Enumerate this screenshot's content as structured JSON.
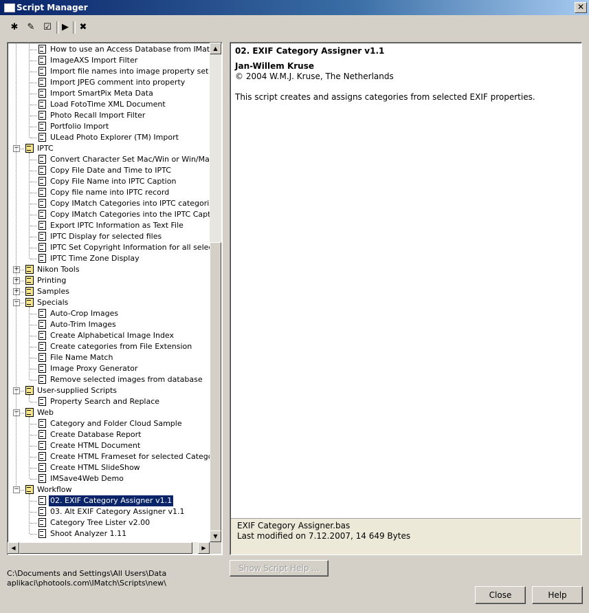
{
  "window": {
    "title": "Script Manager",
    "close_glyph": "✕"
  },
  "toolbar": [
    {
      "name": "new-script-icon",
      "glyph": "✱"
    },
    {
      "name": "edit-script-icon",
      "glyph": "✎"
    },
    {
      "name": "properties-icon",
      "glyph": "☑"
    },
    {
      "name": "run-script-icon",
      "glyph": "▶"
    },
    {
      "name": "delete-script-icon",
      "glyph": "✖"
    }
  ],
  "tree": [
    {
      "level": 1,
      "label": "How to use an Access Database from IMatch"
    },
    {
      "level": 1,
      "label": "ImageAXS Import Filter"
    },
    {
      "level": 1,
      "label": "Import file names into image property set"
    },
    {
      "level": 1,
      "label": "Import JPEG comment into property"
    },
    {
      "level": 1,
      "label": "Import SmartPix Meta Data"
    },
    {
      "level": 1,
      "label": "Load FotoTime XML Document"
    },
    {
      "level": 1,
      "label": "Photo Recall Import Filter"
    },
    {
      "level": 1,
      "label": "Portfolio Import"
    },
    {
      "level": 1,
      "label": "ULead Photo Explorer (TM) Import"
    },
    {
      "level": 0,
      "label": "IPTC",
      "expanded": true
    },
    {
      "level": 1,
      "label": "Convert Character Set Mac/Win or Win/Mac"
    },
    {
      "level": 1,
      "label": "Copy File Date and Time to IPTC"
    },
    {
      "level": 1,
      "label": "Copy File Name into IPTC Caption"
    },
    {
      "level": 1,
      "label": "Copy file name into IPTC record"
    },
    {
      "level": 1,
      "label": "Copy IMatch Categories into IPTC categories"
    },
    {
      "level": 1,
      "label": "Copy IMatch Categories into the IPTC Caption fi"
    },
    {
      "level": 1,
      "label": "Export IPTC Information as Text File"
    },
    {
      "level": 1,
      "label": "IPTC Display for selected files"
    },
    {
      "level": 1,
      "label": "IPTC Set Copyright Information for all selected f"
    },
    {
      "level": 1,
      "label": "IPTC Time Zone Display"
    },
    {
      "level": 0,
      "label": "Nikon Tools",
      "expanded": false
    },
    {
      "level": 0,
      "label": "Printing",
      "expanded": false
    },
    {
      "level": 0,
      "label": "Samples",
      "expanded": false
    },
    {
      "level": 0,
      "label": "Specials",
      "expanded": true
    },
    {
      "level": 1,
      "label": "Auto-Crop Images"
    },
    {
      "level": 1,
      "label": "Auto-Trim Images"
    },
    {
      "level": 1,
      "label": "Create Alphabetical Image Index"
    },
    {
      "level": 1,
      "label": "Create categories from File Extension"
    },
    {
      "level": 1,
      "label": "File Name Match"
    },
    {
      "level": 1,
      "label": "Image Proxy Generator"
    },
    {
      "level": 1,
      "label": "Remove selected images from database"
    },
    {
      "level": 0,
      "label": "User-supplied Scripts",
      "expanded": true
    },
    {
      "level": 1,
      "label": "Property Search and Replace"
    },
    {
      "level": 0,
      "label": "Web",
      "expanded": true
    },
    {
      "level": 1,
      "label": "Category and Folder Cloud Sample"
    },
    {
      "level": 1,
      "label": "Create Database Report"
    },
    {
      "level": 1,
      "label": "Create HTML Document"
    },
    {
      "level": 1,
      "label": "Create HTML Frameset for selected Categories"
    },
    {
      "level": 1,
      "label": "Create HTML SlideShow"
    },
    {
      "level": 1,
      "label": "IMSave4Web Demo"
    },
    {
      "level": 0,
      "label": "Workflow",
      "expanded": true
    },
    {
      "level": 1,
      "label": "02. EXIF Category Assigner v1.1",
      "selected": true
    },
    {
      "level": 1,
      "label": "03. Alt EXIF Category Assigner v1.1"
    },
    {
      "level": 1,
      "label": "Category Tree Lister v2.00"
    },
    {
      "level": 1,
      "label": "Shoot Analyzer 1.11"
    }
  ],
  "scroll": {
    "up": "▲",
    "down": "▼",
    "left": "◀",
    "right": "▶"
  },
  "info": {
    "title": "02. EXIF Category Assigner v1.1",
    "author": "Jan-Willem Kruse",
    "copyright": "© 2004 W.M.J. Kruse, The Netherlands",
    "description": "This script creates and assigns categories from selected EXIF properties.",
    "filename": "EXIF Category Assigner.bas",
    "modified": "Last modified on 7.12.2007, 14 649 Bytes"
  },
  "path": {
    "line1": "C:\\Documents and Settings\\All Users\\Data",
    "line2": "aplikaci\\photools.com\\IMatch\\Scripts\\new\\"
  },
  "buttons": {
    "show_help": "Show Script Help ...",
    "close": "Close",
    "help": "Help"
  }
}
